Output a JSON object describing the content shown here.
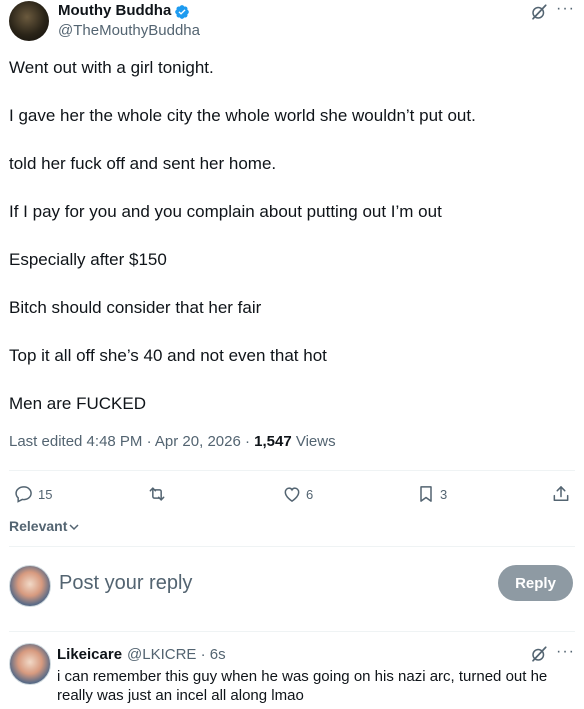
{
  "post": {
    "author_name": "Mouthy Buddha",
    "author_handle": "@TheMouthyBuddha",
    "more_label": "···",
    "lines": [
      "Went out with a girl tonight.",
      "I gave her the whole city the whole world she wouldn’t put out.",
      "told her fuck off and sent her home.",
      "If I pay for you and you complain about putting out I’m out",
      "Especially after $150",
      "Bitch should consider that her fair",
      "Top it all off she’s 40 and not even that hot",
      "Men are FUCKED"
    ],
    "edited_label": "Last edited 4:48 PM · Apr 20, 2026 · ",
    "views_count": "1,547",
    "views_label": " Views"
  },
  "actions": {
    "replies": "15",
    "reposts": "",
    "likes": "6",
    "bookmarks": "3"
  },
  "sort": {
    "label": "Relevant"
  },
  "composer": {
    "placeholder": "Post your reply",
    "reply_label": "Reply"
  },
  "comment": {
    "author_name": "Likeicare",
    "author_handle": "@LKICRE · 6s",
    "more_label": "···",
    "text": "i can remember this guy when he was going on his nazi arc, turned out he really was just an incel all along lmao"
  },
  "colors": {
    "text": "#0f1419",
    "secondary": "#536471",
    "verified": "#1d9bf0",
    "reply_button": "#8e9aa3"
  }
}
